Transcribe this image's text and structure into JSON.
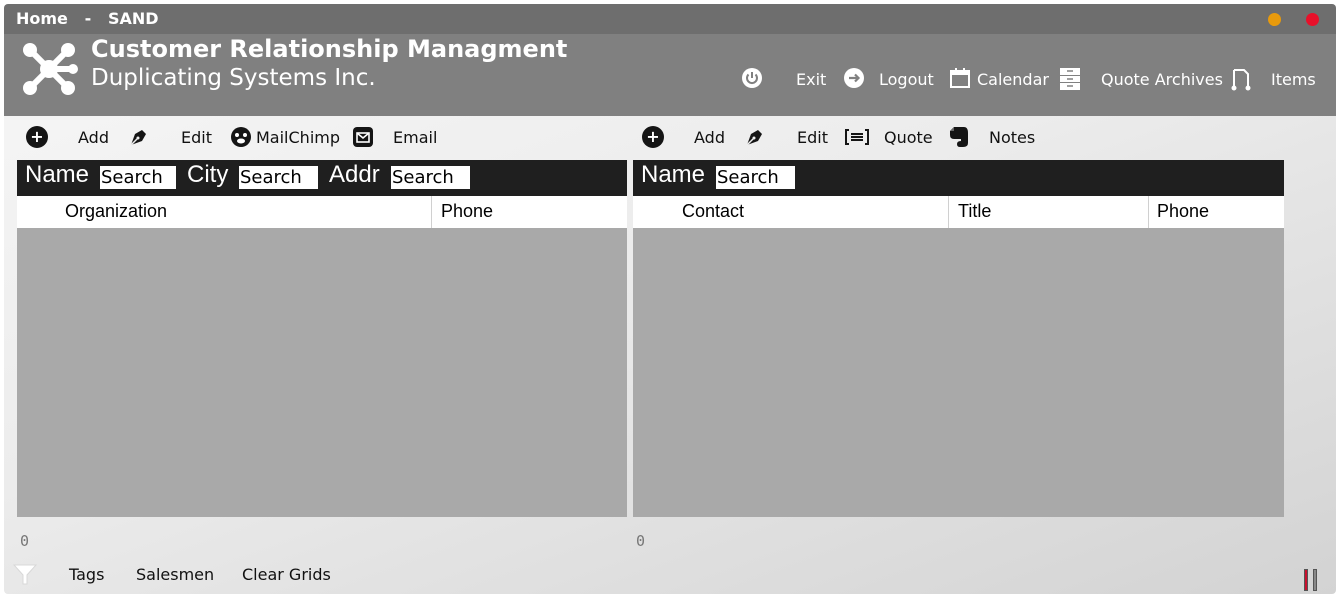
{
  "titlebar": {
    "home": "Home",
    "separator": "-",
    "environment": "SAND",
    "minimize_color": "#e89a0c",
    "close_color": "#e8102a"
  },
  "header": {
    "title": "Customer Relationship Managment",
    "company": "Duplicating Systems Inc.",
    "logo_icon": "network-hub-icon",
    "nav": [
      {
        "icon": "power-icon",
        "label": "Exit"
      },
      {
        "icon": "arrow-right-circle-icon",
        "label": "Logout"
      },
      {
        "icon": "calendar-icon",
        "label": "Calendar"
      },
      {
        "icon": "archive-cabinet-icon",
        "label": "Quote Archives"
      },
      {
        "icon": "route-icon",
        "label": "Items"
      }
    ]
  },
  "left_panel": {
    "toolbar": [
      {
        "icon": "plus-circle-icon",
        "label": "Add"
      },
      {
        "icon": "pen-nib-icon",
        "label": "Edit"
      },
      {
        "icon": "mailchimp-icon",
        "label": "MailChimp"
      },
      {
        "icon": "envelope-icon",
        "label": "Email"
      }
    ],
    "search": [
      {
        "label": "Name",
        "placeholder": "Search"
      },
      {
        "label": "City",
        "placeholder": "Search"
      },
      {
        "label": "Addr",
        "placeholder": "Search"
      }
    ],
    "columns": [
      "Organization",
      "Phone"
    ],
    "rows": [],
    "count": "0"
  },
  "right_panel": {
    "toolbar": [
      {
        "icon": "plus-circle-icon",
        "label": "Add"
      },
      {
        "icon": "pen-nib-icon",
        "label": "Edit"
      },
      {
        "icon": "quote-list-icon",
        "label": "Quote"
      },
      {
        "icon": "evernote-icon",
        "label": "Notes"
      }
    ],
    "search": [
      {
        "label": "Name",
        "placeholder": "Search"
      }
    ],
    "columns": [
      "Contact",
      "Title",
      "Phone"
    ],
    "rows": [],
    "count": "0"
  },
  "footer": {
    "filter_icon": "filter-icon",
    "links": [
      "Tags",
      "Salesmen",
      "Clear Grids"
    ],
    "resize_icon": "resize-grip-icon"
  },
  "colors": {
    "titlebar": "#6e6e6e",
    "banner": "#808080",
    "search_bar": "#1f1f1f",
    "grid_body": "#a9a9a9"
  }
}
